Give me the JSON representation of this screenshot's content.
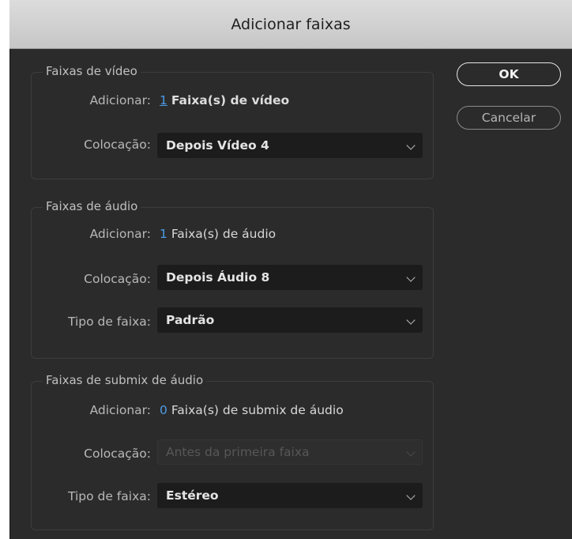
{
  "window": {
    "title": "Adicionar faixas"
  },
  "buttons": {
    "ok": "OK",
    "cancel": "Cancelar"
  },
  "video": {
    "title": "Faixas de vídeo",
    "add_label": "Adicionar:",
    "add_count": "1",
    "add_suffix": "Faixa(s) de vídeo",
    "placement_label": "Colocação:",
    "placement_value": "Depois Vídeo 4"
  },
  "audio": {
    "title": "Faixas de áudio",
    "add_label": "Adicionar:",
    "add_count": "1",
    "add_suffix": "Faixa(s) de áudio",
    "placement_label": "Colocação:",
    "placement_value": "Depois Áudio 8",
    "type_label": "Tipo de faixa:",
    "type_value": "Padrão"
  },
  "submix": {
    "title": "Faixas de submix de áudio",
    "add_label": "Adicionar:",
    "add_count": "0",
    "add_suffix": "Faixa(s) de submix de áudio",
    "placement_label": "Colocação:",
    "placement_value": "Antes da primeira faixa",
    "type_label": "Tipo de faixa:",
    "type_value": "Estéreo"
  },
  "icons": {
    "dropdown": "chevron-down-icon"
  },
  "colors": {
    "accent": "#4b9be6",
    "background": "#2b2b2b",
    "field": "#1c1c1c"
  }
}
